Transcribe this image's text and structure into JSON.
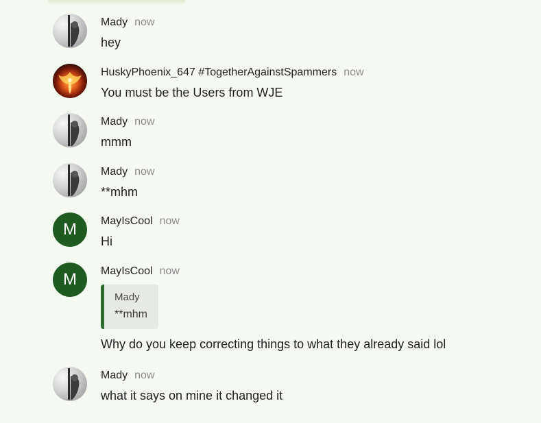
{
  "colors": {
    "background": "#f4faf1",
    "letter_avatar": "#1f5b21",
    "quote_bar": "#2e6b2f",
    "quote_bg": "#e5ebe3",
    "timestamp": "#8a8a8a"
  },
  "messages": [
    {
      "author": "Mady",
      "time": "now",
      "text": "hey",
      "avatar": "photo-avatar"
    },
    {
      "author": "HuskyPhoenix_647 #TogetherAgainstSpammers",
      "time": "now",
      "text": "You must be the Users from WJE",
      "avatar": "phoenix-avatar"
    },
    {
      "author": "Mady",
      "time": "now",
      "text": "mmm",
      "avatar": "photo-avatar"
    },
    {
      "author": "Mady",
      "time": "now",
      "text": "**mhm",
      "avatar": "photo-avatar"
    },
    {
      "author": "MayIsCool",
      "time": "now",
      "text": "Hi",
      "avatar_letter": "M"
    },
    {
      "author": "MayIsCool",
      "time": "now",
      "avatar_letter": "M",
      "reply_to": {
        "author": "Mady",
        "text": "**mhm"
      },
      "text": "Why do you keep correcting things to what they already said lol"
    },
    {
      "author": "Mady",
      "time": "now",
      "text": "what it says on mine it changed it",
      "avatar": "photo-avatar"
    }
  ]
}
